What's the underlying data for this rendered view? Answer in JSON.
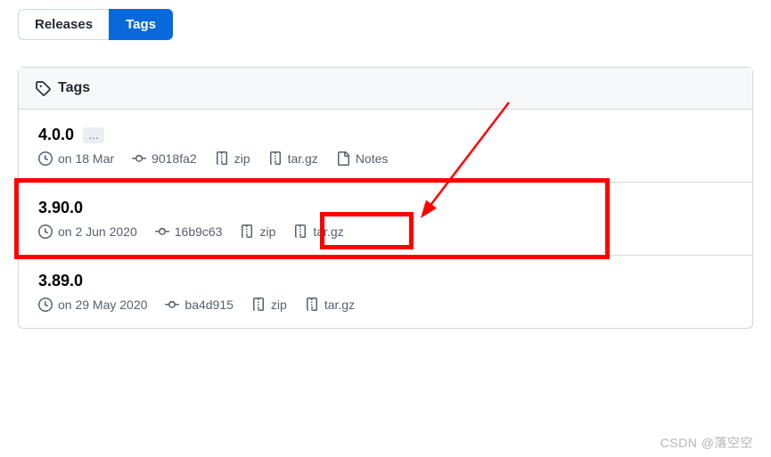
{
  "tabs": {
    "releases": "Releases",
    "tags": "Tags"
  },
  "panel": {
    "header": "Tags"
  },
  "entries": [
    {
      "version": "4.0.0",
      "has_ellipsis": true,
      "date": "on 18 Mar",
      "commit": "9018fa2",
      "zip": "zip",
      "targz": "tar.gz",
      "notes": "Notes"
    },
    {
      "version": "3.90.0",
      "has_ellipsis": false,
      "date": "on 2 Jun 2020",
      "commit": "16b9c63",
      "zip": "zip",
      "targz": "tar.gz",
      "notes": null
    },
    {
      "version": "3.89.0",
      "has_ellipsis": false,
      "date": "on 29 May 2020",
      "commit": "ba4d915",
      "zip": "zip",
      "targz": "tar.gz",
      "notes": null
    }
  ],
  "watermark": "CSDN @落空空"
}
